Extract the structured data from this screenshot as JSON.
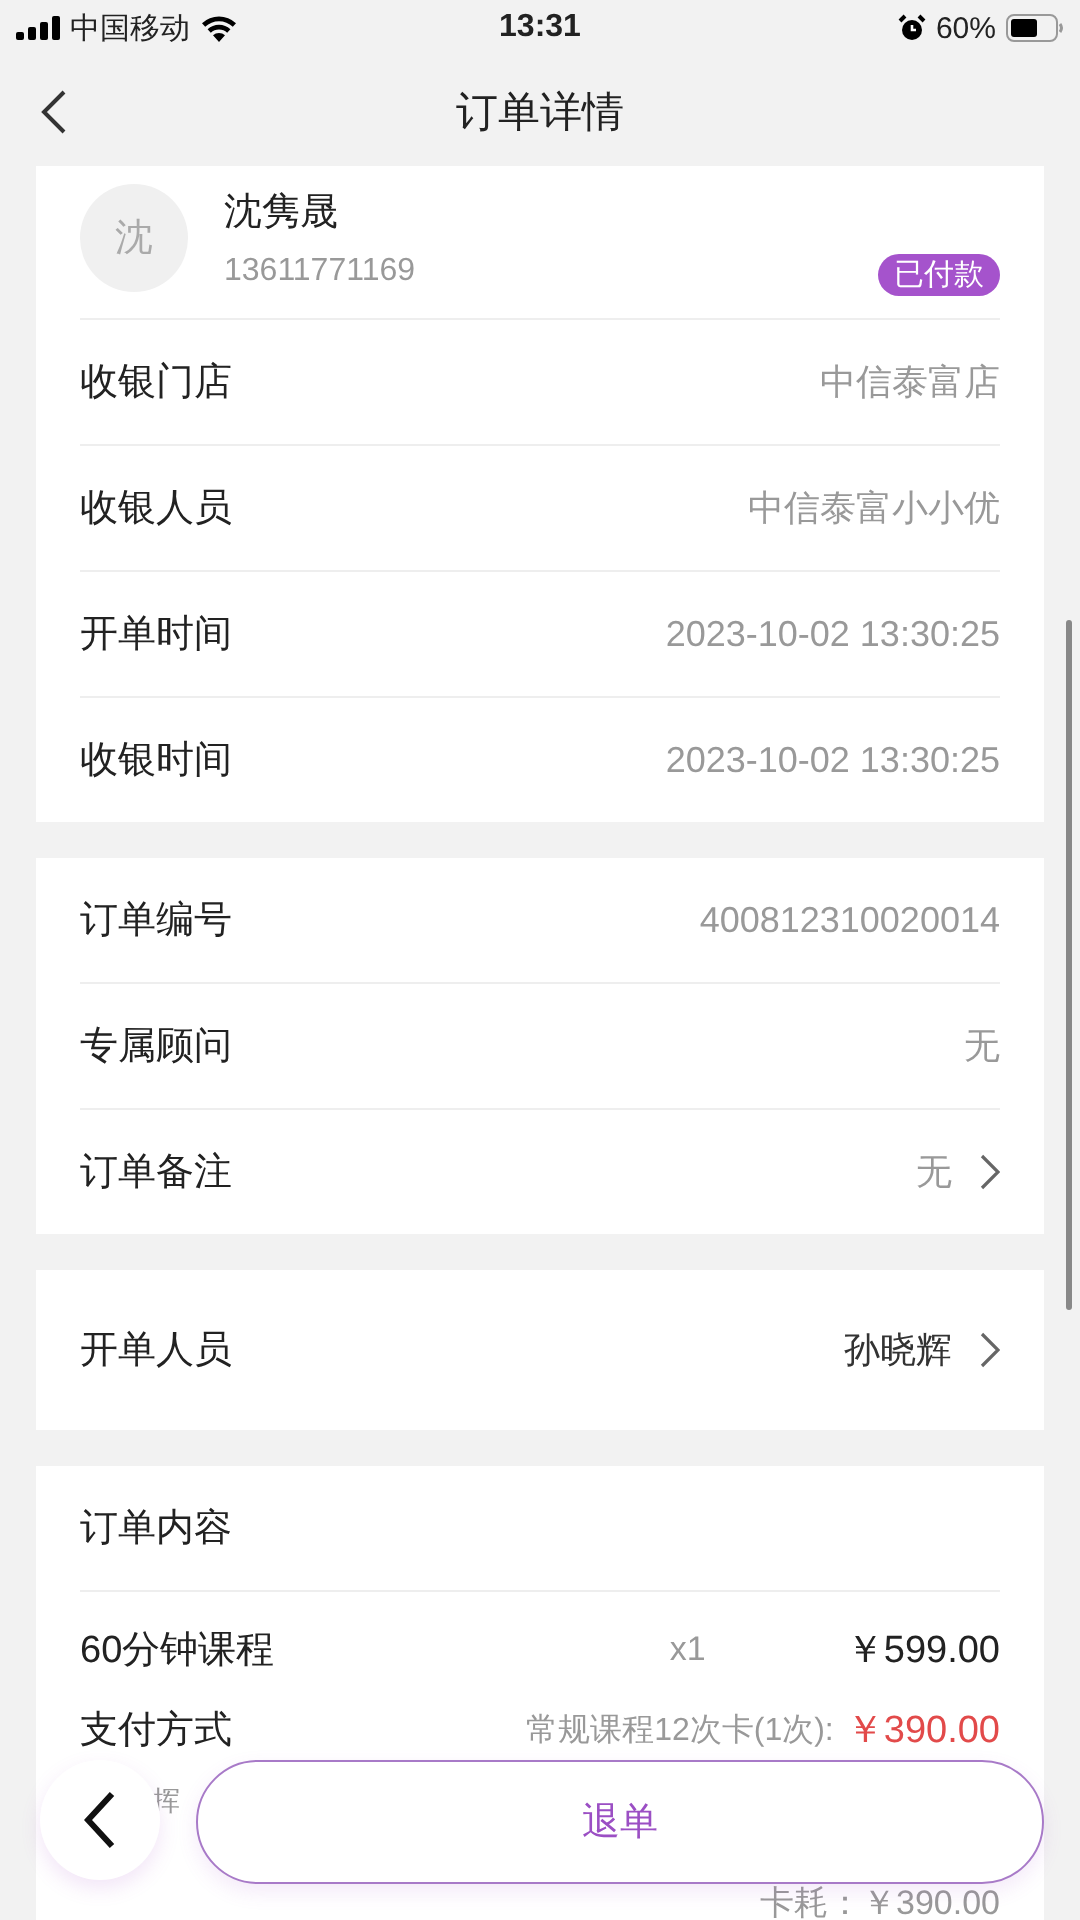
{
  "status_bar": {
    "carrier": "中国移动",
    "time": "13:31",
    "battery": "60%"
  },
  "nav": {
    "title": "订单详情"
  },
  "customer": {
    "avatar": "沈",
    "name": "沈隽晟",
    "phone": "13611771169",
    "badge": "已付款"
  },
  "sections": [
    {
      "rows": [
        {
          "label": "收银门店",
          "value": "中信泰富店",
          "chevron": false
        },
        {
          "label": "收银人员",
          "value": "中信泰富小小优",
          "chevron": false
        },
        {
          "label": "开单时间",
          "value": "2023-10-02 13:30:25",
          "chevron": false
        },
        {
          "label": "收银时间",
          "value": "2023-10-02 13:30:25",
          "chevron": false
        }
      ]
    },
    {
      "rows": [
        {
          "label": "订单编号",
          "value": "400812310020014",
          "chevron": false
        },
        {
          "label": "专属顾问",
          "value": "无",
          "chevron": false
        },
        {
          "label": "订单备注",
          "value": "无",
          "chevron": true
        }
      ]
    },
    {
      "rows": [
        {
          "label": "开单人员",
          "value": "孙晓辉",
          "chevron": true
        }
      ]
    }
  ],
  "order_content": {
    "title": "订单内容",
    "items": [
      {
        "name": "60分钟课程",
        "qty": "x1",
        "price": "￥599.00"
      }
    ],
    "payment": {
      "label": "支付方式",
      "method": "常规课程12次卡(1次):",
      "amount": "￥390.00"
    },
    "covered_text": "挥",
    "card_cost": "卡耗：￥390.00"
  },
  "footer": {
    "button": "退单"
  }
}
